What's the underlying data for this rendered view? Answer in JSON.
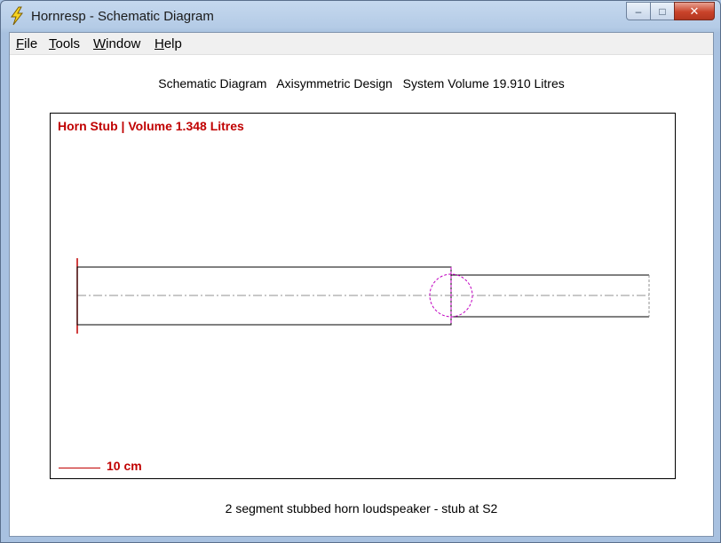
{
  "window": {
    "title": "Hornresp - Schematic Diagram",
    "minimize_glyph": "–",
    "maximize_glyph": "□",
    "close_glyph": "✕",
    "icon": "lightning-bolt-icon"
  },
  "menu": {
    "items": [
      {
        "hotkey": "F",
        "rest": "ile"
      },
      {
        "hotkey": "T",
        "rest": "ools"
      },
      {
        "hotkey": "W",
        "rest": "indow"
      },
      {
        "hotkey": "H",
        "rest": "elp"
      }
    ]
  },
  "heading": "Schematic Diagram   Axisymmetric Design   System Volume 19.910 Litres",
  "diagram": {
    "stub_label": "Horn Stub | Volume 1.348 Litres",
    "scale_label": "10 cm"
  },
  "caption": "2 segment stubbed horn loudspeaker - stub at S2",
  "colors": {
    "label_red": "#c00000",
    "driver_magenta": "#c000c0",
    "axis_gray": "#909090"
  }
}
